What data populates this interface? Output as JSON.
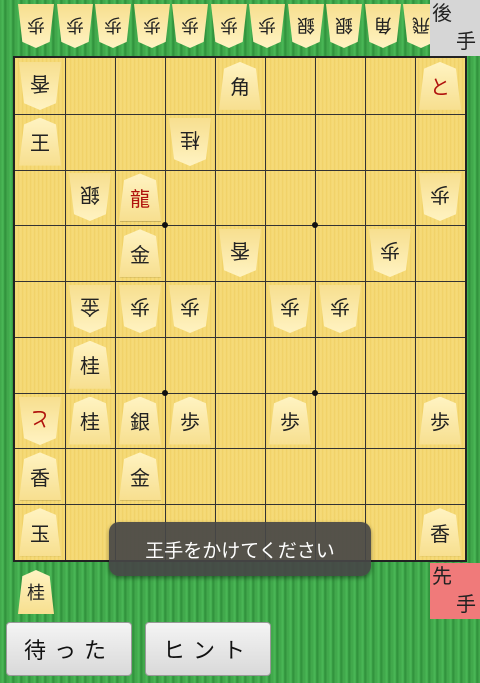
{
  "gote_label": {
    "line1": "後",
    "line2": "手"
  },
  "sente_label": {
    "line1": "先",
    "line2": "手"
  },
  "gote_hand": [
    "歩",
    "歩",
    "歩",
    "歩",
    "歩",
    "歩",
    "歩",
    "銀",
    "銀",
    "角",
    "飛"
  ],
  "sente_hand": [
    "桂"
  ],
  "board": [
    {
      "c": 1,
      "r": 1,
      "t": "香",
      "s": "gote"
    },
    {
      "c": 5,
      "r": 1,
      "t": "角",
      "s": "sente"
    },
    {
      "c": 9,
      "r": 1,
      "t": "と",
      "s": "sente",
      "red": true
    },
    {
      "c": 1,
      "r": 2,
      "t": "王",
      "s": "sente"
    },
    {
      "c": 4,
      "r": 2,
      "t": "桂",
      "s": "gote"
    },
    {
      "c": 2,
      "r": 3,
      "t": "銀",
      "s": "gote"
    },
    {
      "c": 3,
      "r": 3,
      "t": "龍",
      "s": "sente",
      "red": true
    },
    {
      "c": 9,
      "r": 3,
      "t": "歩",
      "s": "gote"
    },
    {
      "c": 3,
      "r": 4,
      "t": "金",
      "s": "sente"
    },
    {
      "c": 5,
      "r": 4,
      "t": "香",
      "s": "gote"
    },
    {
      "c": 8,
      "r": 4,
      "t": "歩",
      "s": "gote"
    },
    {
      "c": 2,
      "r": 5,
      "t": "金",
      "s": "gote"
    },
    {
      "c": 3,
      "r": 5,
      "t": "歩",
      "s": "gote"
    },
    {
      "c": 4,
      "r": 5,
      "t": "歩",
      "s": "gote"
    },
    {
      "c": 6,
      "r": 5,
      "t": "歩",
      "s": "gote"
    },
    {
      "c": 7,
      "r": 5,
      "t": "歩",
      "s": "gote"
    },
    {
      "c": 2,
      "r": 6,
      "t": "桂",
      "s": "sente"
    },
    {
      "c": 1,
      "r": 7,
      "t": "と",
      "s": "gote",
      "red": true
    },
    {
      "c": 2,
      "r": 7,
      "t": "桂",
      "s": "sente"
    },
    {
      "c": 3,
      "r": 7,
      "t": "銀",
      "s": "sente"
    },
    {
      "c": 4,
      "r": 7,
      "t": "歩",
      "s": "sente"
    },
    {
      "c": 6,
      "r": 7,
      "t": "歩",
      "s": "sente"
    },
    {
      "c": 9,
      "r": 7,
      "t": "歩",
      "s": "sente"
    },
    {
      "c": 1,
      "r": 8,
      "t": "香",
      "s": "sente"
    },
    {
      "c": 3,
      "r": 8,
      "t": "金",
      "s": "sente"
    },
    {
      "c": 1,
      "r": 9,
      "t": "玉",
      "s": "sente"
    },
    {
      "c": 9,
      "r": 9,
      "t": "香",
      "s": "sente"
    }
  ],
  "toast": "王手をかけてください",
  "buttons": {
    "matta": "待った",
    "hint": "ヒント"
  }
}
